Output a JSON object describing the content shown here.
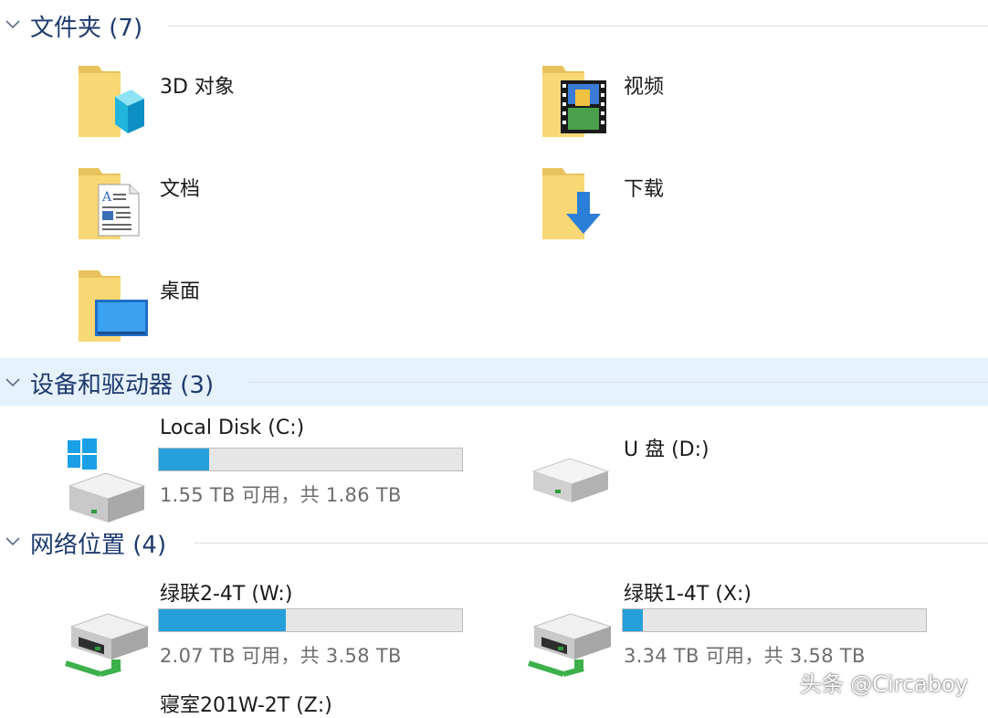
{
  "groups": {
    "folders": {
      "title": "文件夹 (7)"
    },
    "devices": {
      "title": "设备和驱动器 (3)"
    },
    "network": {
      "title": "网络位置 (4)"
    }
  },
  "folders": [
    {
      "label": "3D 对象",
      "icon": "3d-objects-folder-icon"
    },
    {
      "label": "视频",
      "icon": "videos-folder-icon"
    },
    {
      "label": "文档",
      "icon": "documents-folder-icon"
    },
    {
      "label": "下载",
      "icon": "downloads-folder-icon"
    },
    {
      "label": "桌面",
      "icon": "desktop-folder-icon"
    }
  ],
  "drives": [
    {
      "label": "Local Disk (C:)",
      "free_text": "1.55 TB 可用，共 1.86 TB",
      "used_fraction": 0.167,
      "icon": "windows-system-drive-icon"
    },
    {
      "label": "U 盘 (D:)",
      "icon": "removable-drive-icon"
    }
  ],
  "network_drives": [
    {
      "label": "绿联2-4T (W:)",
      "free_text": "2.07 TB 可用，共 3.58 TB",
      "used_fraction": 0.42,
      "icon": "network-drive-icon"
    },
    {
      "label": "绿联1-4T (X:)",
      "free_text": "3.34 TB 可用，共 3.58 TB",
      "used_fraction": 0.067,
      "icon": "network-drive-icon"
    },
    {
      "label": "寝室201W-2T (Z:)",
      "icon": "network-drive-icon"
    }
  ],
  "watermark": "头条 @Circaboy",
  "colors": {
    "bar_fill": "#26a0da",
    "bar_track": "#e6e6e6",
    "header_text": "#1e3a6e",
    "selected_header": "#e5f1fb"
  }
}
